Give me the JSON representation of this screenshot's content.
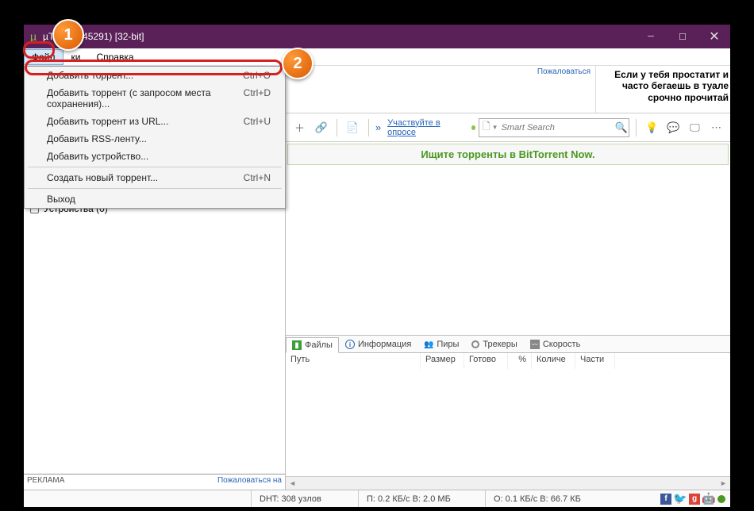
{
  "title": "µT           (build 45291) [32-bit]",
  "menubar": {
    "file": "Файл",
    "settings": "ки",
    "help": "Справка"
  },
  "file_menu": [
    {
      "label": "Добавить торрент...",
      "shortcut": "Ctrl+O"
    },
    {
      "label": "Добавить торрент (с запросом места сохранения)...",
      "shortcut": "Ctrl+D"
    },
    {
      "label": "Добавить торрент из URL...",
      "shortcut": "Ctrl+U"
    },
    {
      "label": "Добавить RSS-ленту..."
    },
    {
      "label": "Добавить устройство..."
    },
    {
      "sep": true
    },
    {
      "label": "Создать новый торрент...",
      "shortcut": "Ctrl+N"
    },
    {
      "sep": true
    },
    {
      "label": "Выход"
    }
  ],
  "sidebar": {
    "devices": "Устройства (0)",
    "ad_label": "РЕКЛАМА",
    "complain": "Пожаловаться на"
  },
  "ad_top": {
    "complain": "Пожаловаться",
    "text_line1": "Если у тебя простатит и",
    "text_line2": "часто бегаешь в туале",
    "text_line3": "срочно прочитай"
  },
  "toolbar": {
    "survey": "Участвуйте в опросе",
    "search_placeholder": "Smart Search"
  },
  "promo": "Ищите торренты в BitTorrent Now.",
  "tabs": {
    "files": "Файлы",
    "info": "Информация",
    "peers": "Пиры",
    "trackers": "Трекеры",
    "speed": "Скорость"
  },
  "columns": {
    "path": "Путь",
    "size": "Размер",
    "done": "Готово",
    "pct": "%",
    "count": "Количе",
    "parts": "Части"
  },
  "status": {
    "dht": "DHT: 308 узлов",
    "down": "П: 0.2 КБ/с В: 2.0 МБ",
    "up": "О: 0.1 КБ/с В: 66.7 КБ"
  },
  "annotations": {
    "one": "1",
    "two": "2"
  }
}
